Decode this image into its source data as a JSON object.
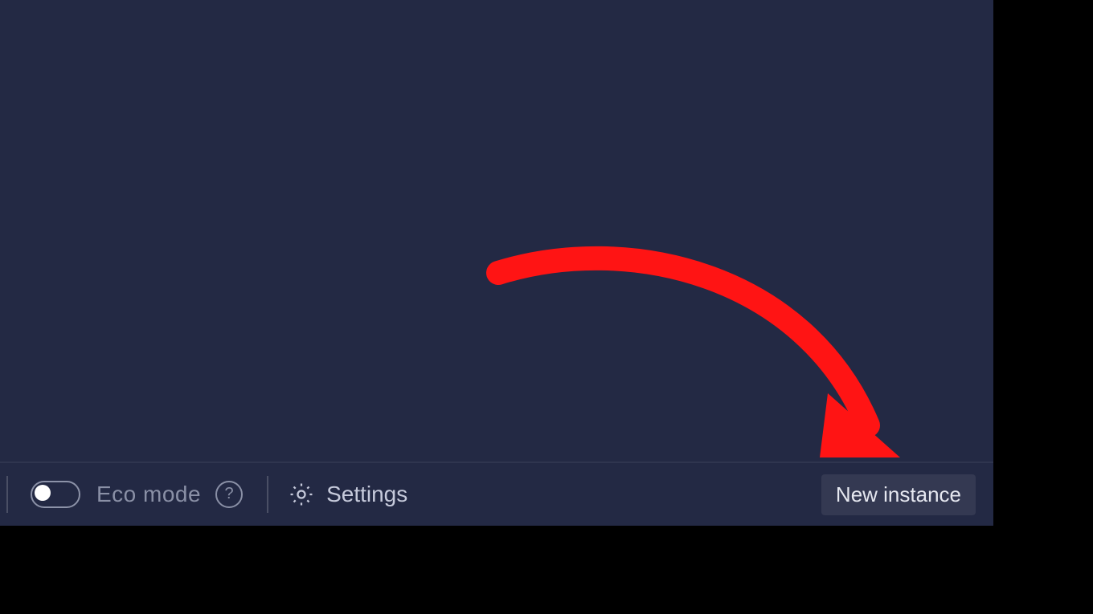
{
  "bottom_bar": {
    "eco_mode_label": "Eco mode",
    "eco_mode_on": false,
    "settings_label": "Settings",
    "new_instance_label": "New instance"
  },
  "icons": {
    "help": "help-icon",
    "gear": "gear-icon",
    "toggle": "toggle-icon"
  },
  "annotation": {
    "arrow_color": "#ff1414",
    "target": "new-instance-button"
  }
}
